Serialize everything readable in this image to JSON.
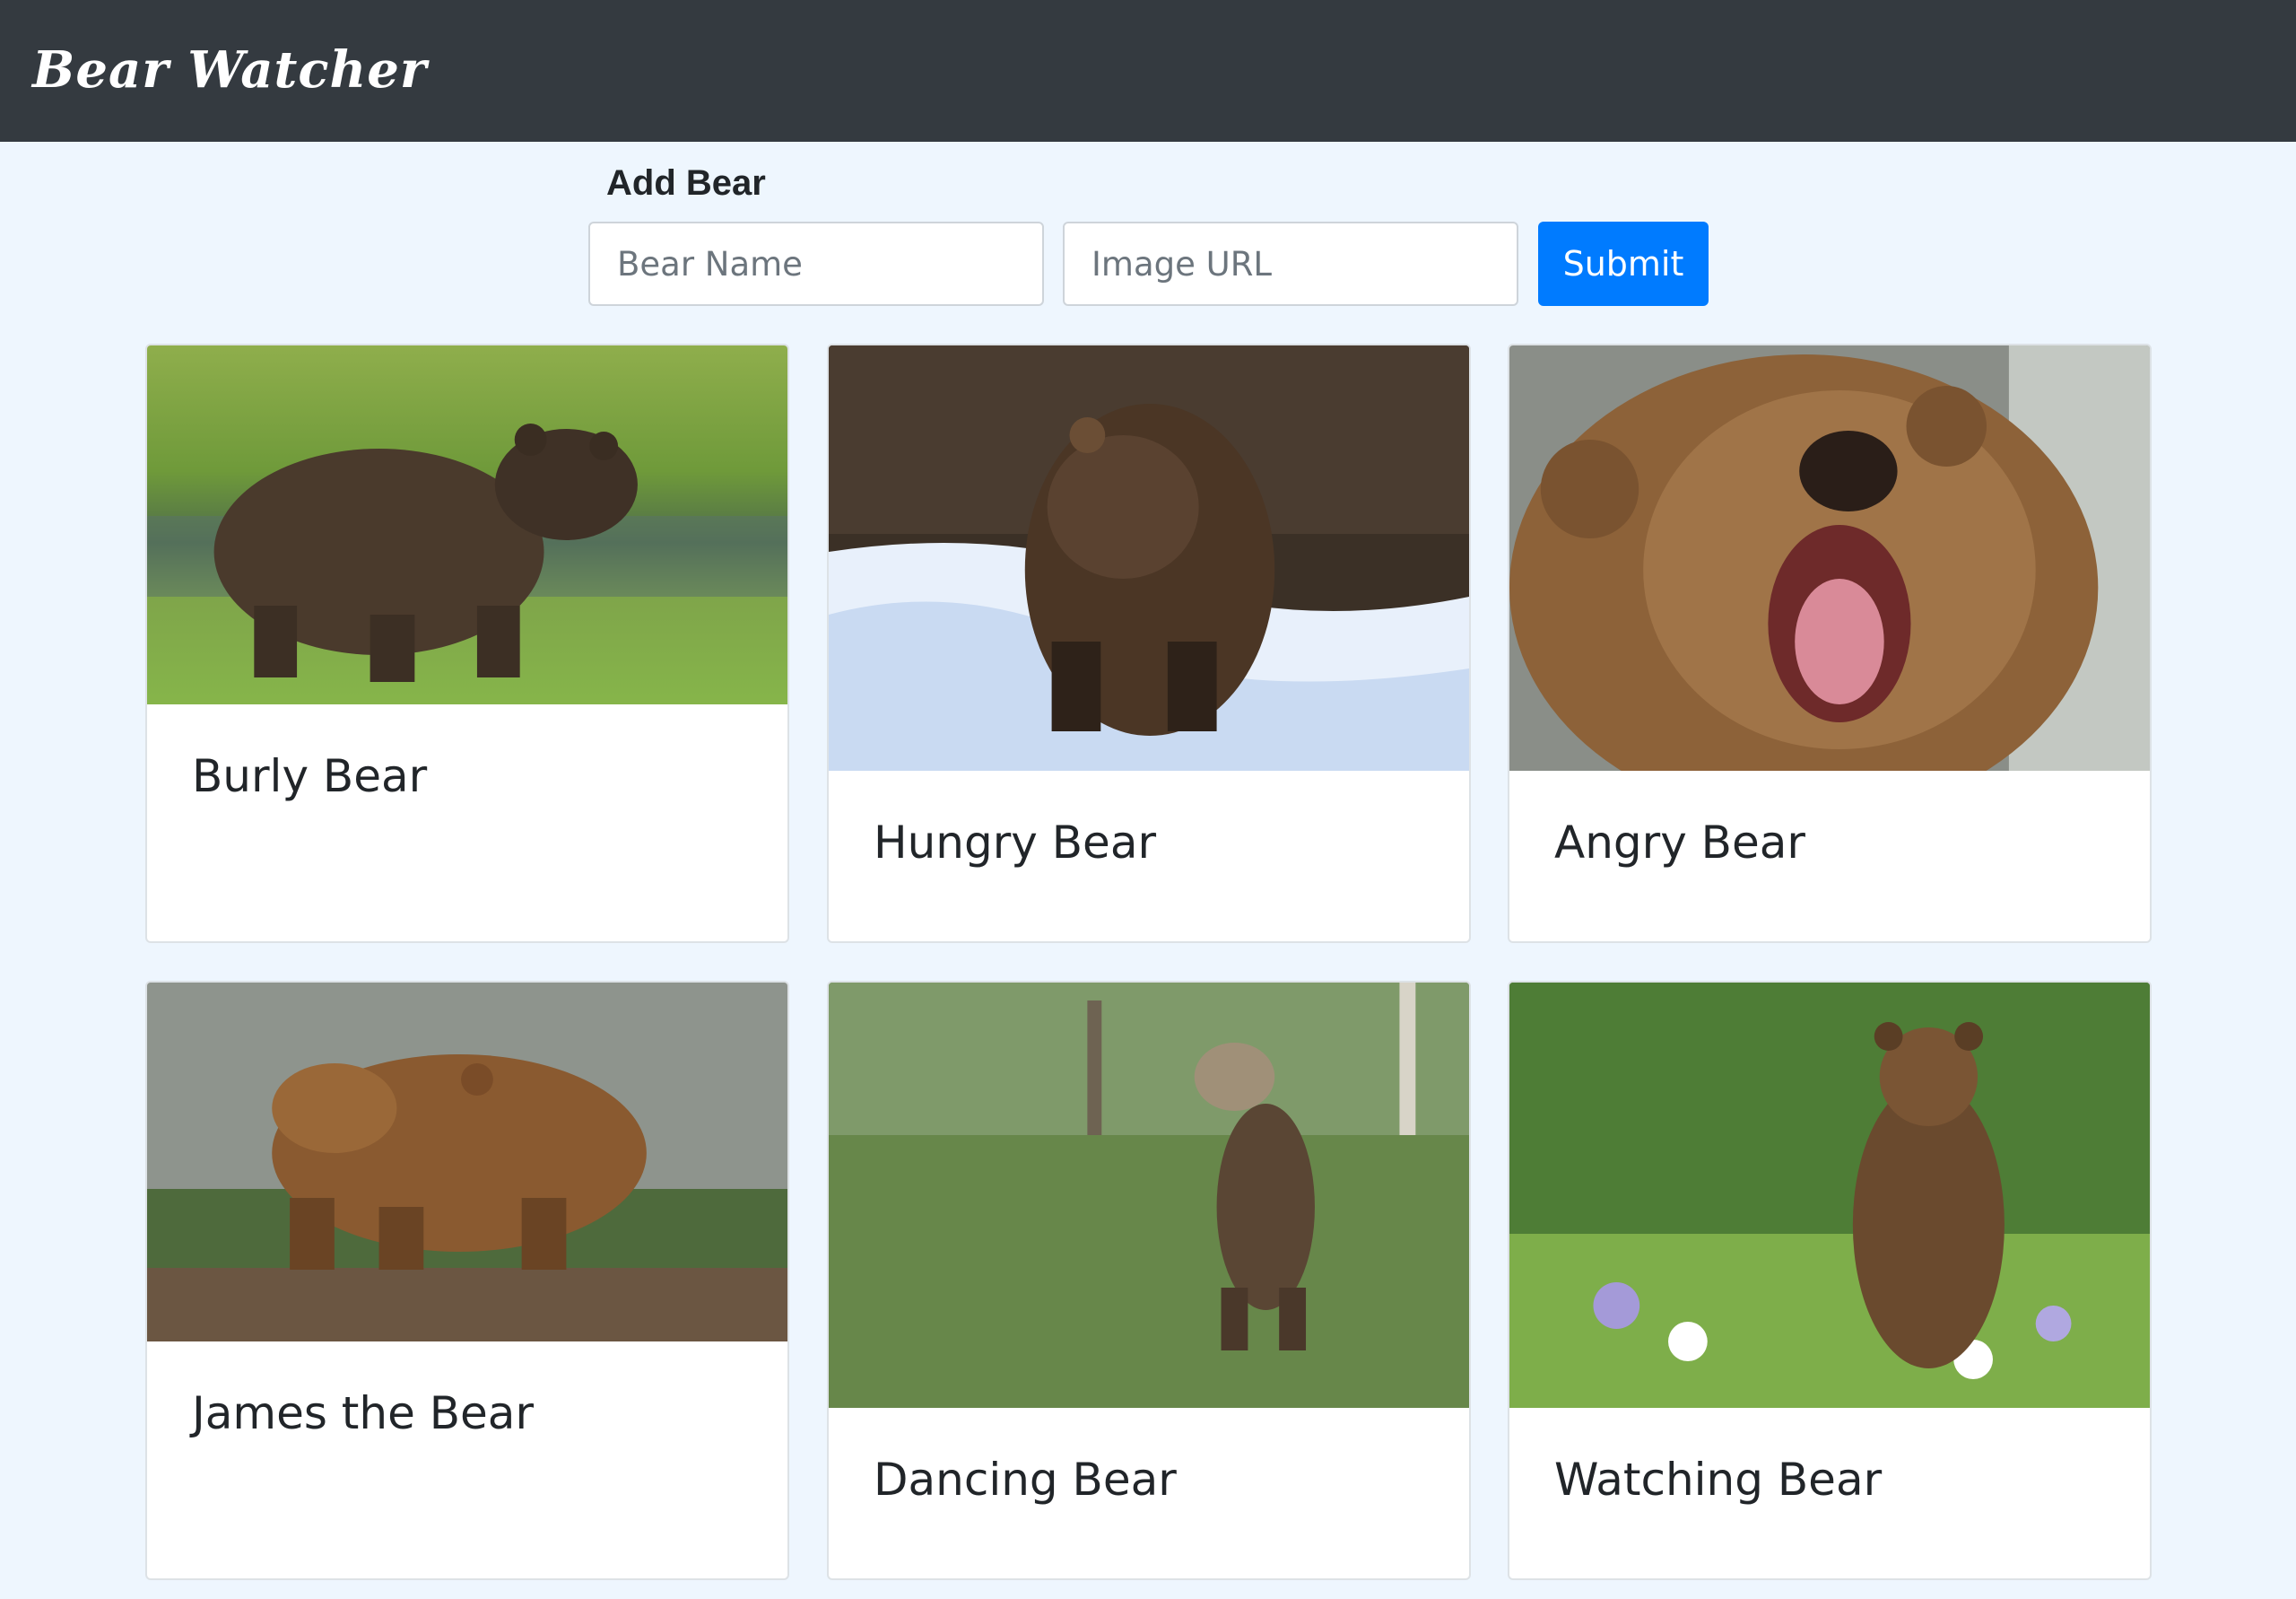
{
  "navbar": {
    "brand": "Bear Watcher"
  },
  "form": {
    "title": "Add Bear",
    "name_placeholder": "Bear Name",
    "url_placeholder": "Image URL",
    "submit_label": "Submit"
  },
  "bears": [
    {
      "name": "Burly Bear"
    },
    {
      "name": "Hungry Bear"
    },
    {
      "name": "Angry Bear"
    },
    {
      "name": "James the Bear"
    },
    {
      "name": "Dancing Bear"
    },
    {
      "name": "Watching Bear"
    }
  ],
  "colors": {
    "navbar_bg": "#343a40",
    "page_bg": "#eef6fe",
    "primary": "#007bff"
  }
}
